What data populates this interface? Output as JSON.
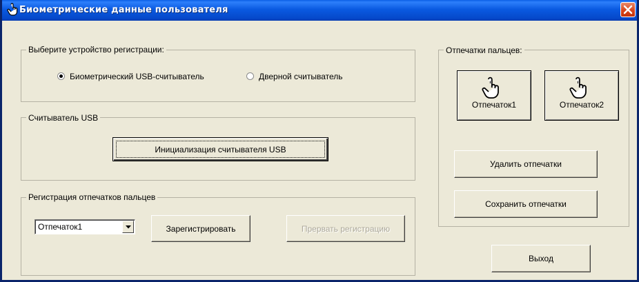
{
  "window": {
    "title": "Биометрические данные пользователя"
  },
  "device_group": {
    "label": "Выберите устройство регистрации:",
    "options": [
      {
        "label": "Биометрический USB-считыватель",
        "selected": true
      },
      {
        "label": "Дверной считыватель",
        "selected": false
      }
    ]
  },
  "usb_group": {
    "label": "Считыватель USB",
    "init_button": "Инициализация считывателя USB"
  },
  "registration_group": {
    "label": "Регистрация отпечатков пальцев",
    "select_value": "Отпечаток1",
    "register_button": "Зарегистрировать",
    "abort_button": "Прервать регистрацию"
  },
  "fingerprints_group": {
    "label": "Отпечатки пальцев:",
    "items": [
      {
        "label": "Отпечаток1"
      },
      {
        "label": "Отпечаток2"
      }
    ],
    "delete_button": "Удалить отпечатки",
    "save_button": "Сохранить отпечатки"
  },
  "exit_button": "Выход",
  "icons": {
    "title": "hand-pointer-icon",
    "close": "close-icon",
    "fingerprint": "hand-pointer-icon",
    "dropdown": "chevron-down-icon"
  },
  "colors": {
    "titlebar": "#0a5ae1",
    "dialog_bg": "#ece9d8",
    "close_button": "#d8451c",
    "disabled_text": "#aca899"
  }
}
